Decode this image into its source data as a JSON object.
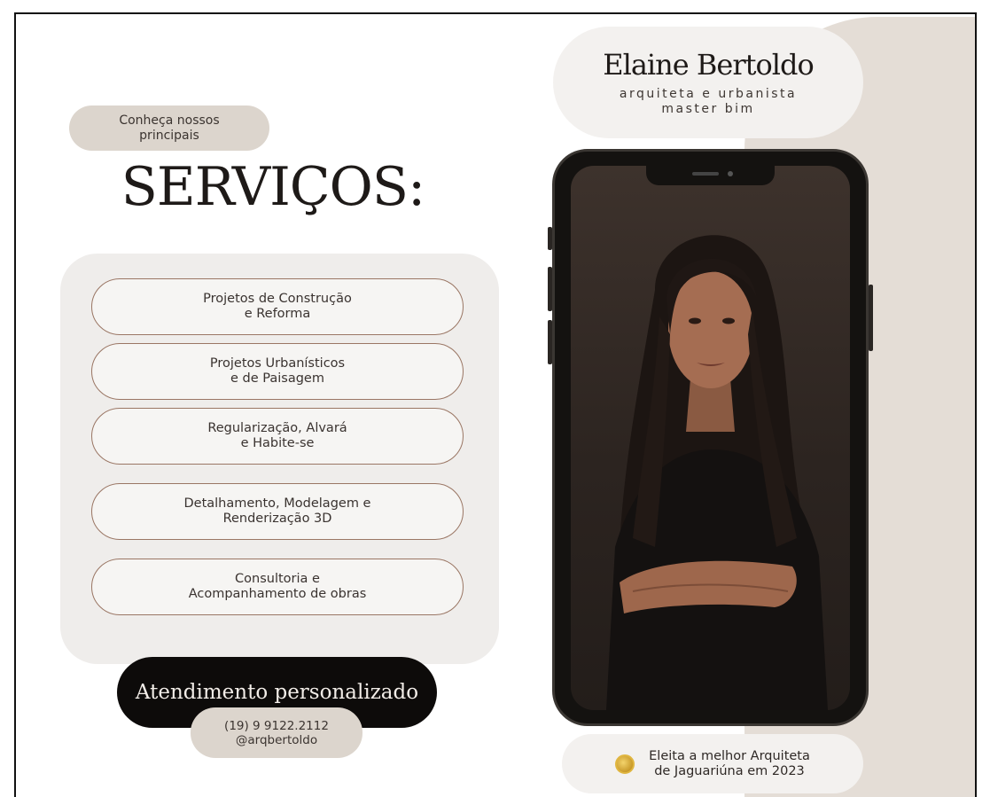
{
  "header": {
    "name": "Elaine Bertoldo",
    "subtitle_line1": "arquiteta e urbanista",
    "subtitle_line2": "master bim"
  },
  "intro": {
    "line1": "Conheça nossos",
    "line2": "principais"
  },
  "services_title": "SERVIÇOS:",
  "services": [
    {
      "line1": "Projetos de Construção",
      "line2": "e Reforma"
    },
    {
      "line1": "Projetos Urbanísticos",
      "line2": "e de Paisagem"
    },
    {
      "line1": "Regularização, Alvará",
      "line2": "e Habite-se"
    },
    {
      "line1": "Detalhamento, Modelagem e",
      "line2": "Renderização 3D"
    },
    {
      "line1": "Consultoria e",
      "line2": "Acompanhamento de obras"
    }
  ],
  "cta": "Atendimento personalizado",
  "contact": {
    "phone": "(19) 9 9122.2112",
    "handle": "@arqbertoldo"
  },
  "award": {
    "line1": "Eleita a melhor Arquiteta",
    "line2": "de Jaguariúna em 2023",
    "icon": "medal-icon"
  },
  "colors": {
    "beige": "#e4ddd6",
    "pill_beige": "#dcd5cd",
    "panel_gray": "#efedeb",
    "outline_brown": "#9a7664",
    "black": "#0d0b0a"
  }
}
